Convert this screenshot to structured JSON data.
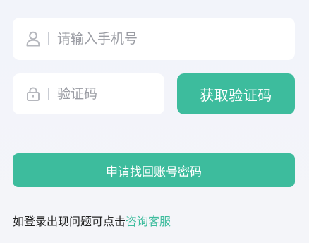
{
  "phone": {
    "placeholder": "请输入手机号",
    "value": "",
    "icon": "user-icon"
  },
  "code": {
    "placeholder": "验证码",
    "value": "",
    "icon": "lock-icon"
  },
  "get_code_label": "获取验证码",
  "submit_label": "申请找回账号密码",
  "help": {
    "text": "如登录出现问题可点击",
    "link": "咨询客服"
  },
  "colors": {
    "accent": "#3dbc9d",
    "background": "#f3f4f9",
    "icon": "#b5b7bd"
  }
}
